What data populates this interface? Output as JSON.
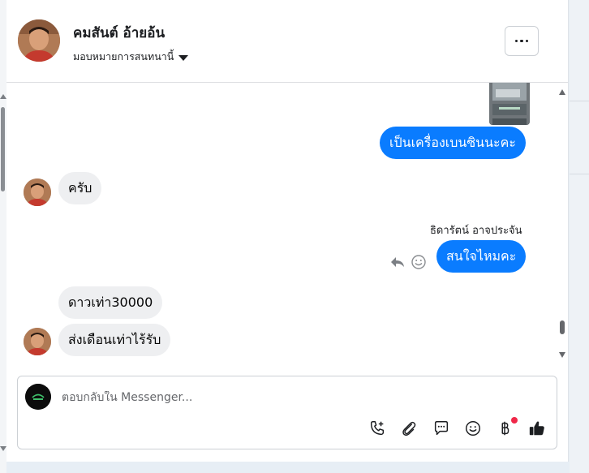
{
  "contact": {
    "name": "คมสันต์ อ้ายอ้น",
    "assign_label": "มอบหมายการสนทนานี้"
  },
  "header": {
    "more_icon": "more-horizontal-icon"
  },
  "messages": [
    {
      "direction": "outgoing",
      "text": "เป็นเครื่องเบนซินนะคะ"
    },
    {
      "direction": "incoming",
      "text": "ครับ"
    },
    {
      "direction": "outgoing",
      "sender": "ธิดารัตน์ อาจประจัน",
      "text": "สนใจไหมคะ"
    },
    {
      "direction": "incoming",
      "text": "ดาวเท่า30000"
    },
    {
      "direction": "incoming",
      "text": "ส่งเดือนเท่าไร้รับ"
    }
  ],
  "composer": {
    "placeholder": "ตอบกลับใน Messenger...",
    "tools": [
      "call-add-icon",
      "attachment-icon",
      "saved-reply-icon",
      "emoji-icon",
      "baht-payment-icon",
      "like-icon"
    ]
  },
  "colors": {
    "outgoing_bubble": "#0a7cff",
    "incoming_bubble": "#eeeff1",
    "notification_dot": "#f02849"
  }
}
